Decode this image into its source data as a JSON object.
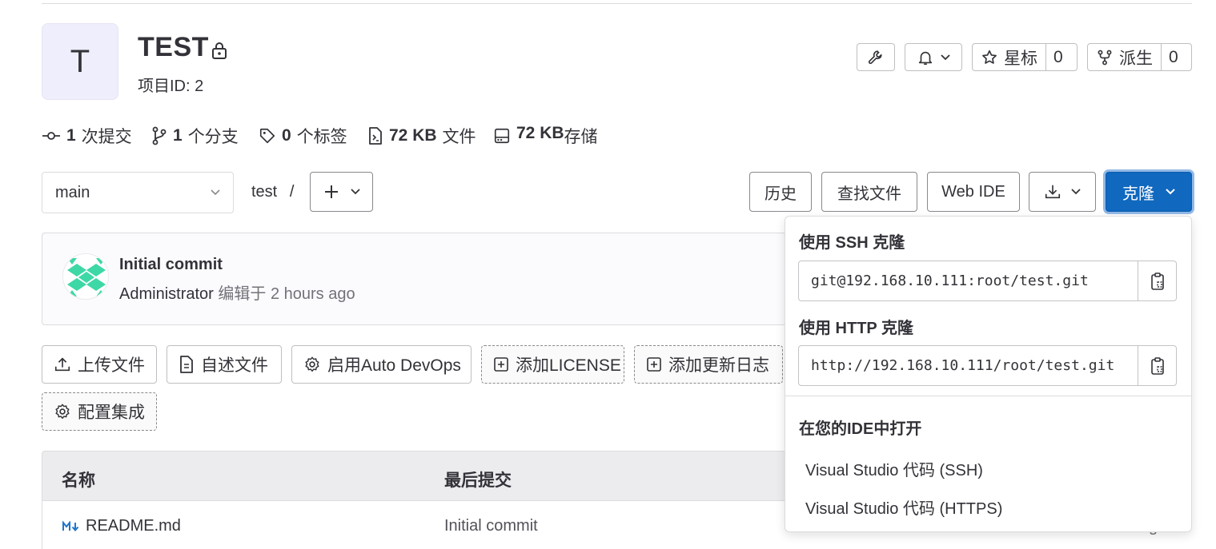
{
  "project": {
    "avatar_letter": "T",
    "title": "TEST",
    "id_label": "项目ID: 2"
  },
  "header_buttons": {
    "star_label": "星标",
    "star_count": "0",
    "fork_label": "派生",
    "fork_count": "0"
  },
  "stats": [
    {
      "icon": "commit-icon",
      "num": "1",
      "label": "次提交"
    },
    {
      "icon": "branch-icon",
      "num": "1",
      "label": "个分支"
    },
    {
      "icon": "tag-icon",
      "num": "0",
      "label": "个标签"
    },
    {
      "icon": "file-icon",
      "num": "72 KB",
      "label": "文件"
    },
    {
      "icon": "storage-icon",
      "num": "72 KB",
      "label": "存储"
    }
  ],
  "toolbar": {
    "branch": "main",
    "breadcrumb": "test",
    "breadcrumb_sep": "/",
    "history": "历史",
    "find_file": "查找文件",
    "web_ide": "Web IDE",
    "clone": "克隆"
  },
  "commit": {
    "title": "Initial commit",
    "author": "Administrator",
    "action": "编辑于",
    "time": "2 hours ago"
  },
  "actions": {
    "upload": "上传文件",
    "readme": "自述文件",
    "autodevops": "启用Auto DevOps",
    "license": "添加LICENSE",
    "changelog": "添加更新日志",
    "integrations": "配置集成"
  },
  "table": {
    "col_name": "名称",
    "col_commit": "最后提交",
    "rows": [
      {
        "name": "README.md",
        "commit": "Initial commit"
      }
    ]
  },
  "clone_dropdown": {
    "ssh_heading": "使用 SSH 克隆",
    "ssh_url": "git@192.168.10.111:root/test.git",
    "http_heading": "使用 HTTP 克隆",
    "http_url": "http://192.168.10.111/root/test.git",
    "ide_heading": "在您的IDE中打开",
    "ide_items": [
      "Visual Studio 代码 (SSH)",
      "Visual Studio 代码 (HTTPS)"
    ]
  },
  "colors": {
    "primary": "#1068bf",
    "avatar_bg": "#eeeefc",
    "table_head_bg": "#ececef"
  }
}
